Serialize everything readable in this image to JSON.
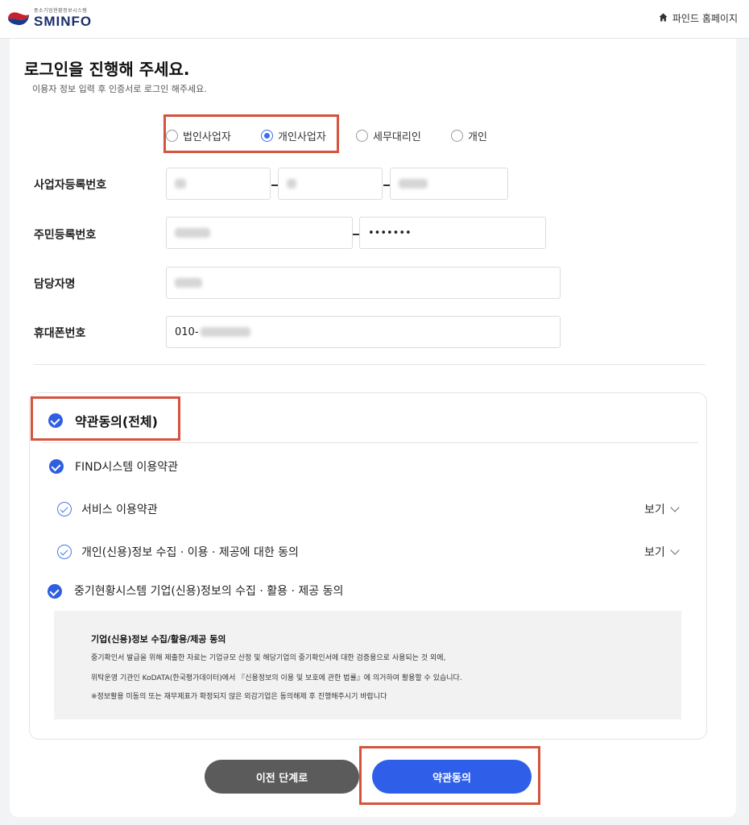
{
  "header": {
    "logo_sub": "중소기업현황정보시스템",
    "logo_main": "SMINFO",
    "home_link": "파인드 홈페이지"
  },
  "page": {
    "title": "로그인을 진행해 주세요.",
    "subtitle": "이용자 정보 입력 후 인증서로 로그인 해주세요."
  },
  "user_type": {
    "options": [
      "법인사업자",
      "개인사업자",
      "세무대리인",
      "개인"
    ],
    "selected": "개인사업자"
  },
  "form": {
    "business_reg_label": "사업자등록번호",
    "resident_reg_label": "주민등록번호",
    "resident_back_value": "•••••••",
    "manager_label": "담당자명",
    "phone_label": "휴대폰번호",
    "phone_prefix": "010-"
  },
  "terms": {
    "all_label": "약관동의(전체)",
    "find_label": "FIND시스템 이용약관",
    "service_label": "서비스 이용약관",
    "privacy_label": "개인(신용)정보 수집 · 이용 · 제공에 대한 동의",
    "view_label": "보기",
    "sminfo_label": "중기현황시스템 기업(신용)정보의 수집 · 활용 · 제공 동의",
    "notice_title": "기업(신용)정보 수집/활용/제공 동의",
    "notice_line1": "중기확인서 발급을 위해 제출한 자료는 기업규모 산정 및 해당기업의 중기확인서에 대한 검증용으로 사용되는 것 외에,",
    "notice_line2": "위탁운영 기관인 KoDATA(한국평가데이터)에서 『신용정보의 이용 및 보호에 관한 법률』에 의거하여 활용할 수 있습니다.",
    "notice_line3": "※정보활용 미동의 또는 재무제표가 확정되지 않은 외감기업은 동의해제 후 진행해주시기 바랍니다"
  },
  "buttons": {
    "prev": "이전 단계로",
    "agree": "약관동의"
  },
  "colors": {
    "accent": "#2f5fe8",
    "highlight": "#d4543e",
    "prev_button": "#5b5b5b"
  }
}
